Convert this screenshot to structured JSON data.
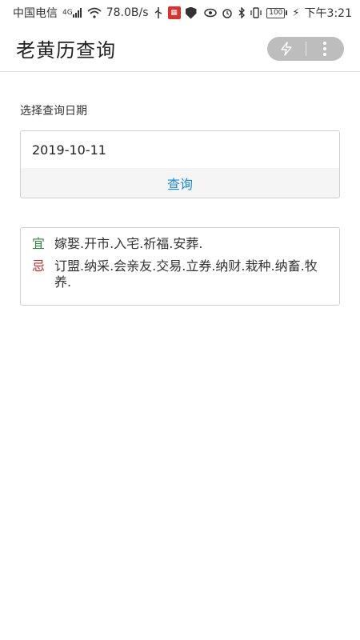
{
  "statusbar": {
    "carrier": "中国电信",
    "network_tag": "4G",
    "speed": "78.0B/s",
    "battery": "100",
    "time": "下午3:21"
  },
  "toolbar": {
    "title": "老黄历查询"
  },
  "form": {
    "label": "选择查询日期",
    "date_value": "2019-10-11",
    "button_label": "查询"
  },
  "result": {
    "yi_label": "宜",
    "yi_text": "嫁娶.开市.入宅.祈福.安葬.",
    "ji_label": "忌",
    "ji_text": "订盟.纳采.会亲友.交易.立券.纳财.栽种.纳畜.牧养."
  },
  "colors": {
    "accent": "#1a8ad6",
    "yi": "#2e8b3a",
    "ji": "#c62828",
    "capsule": "#bdbdbd"
  }
}
